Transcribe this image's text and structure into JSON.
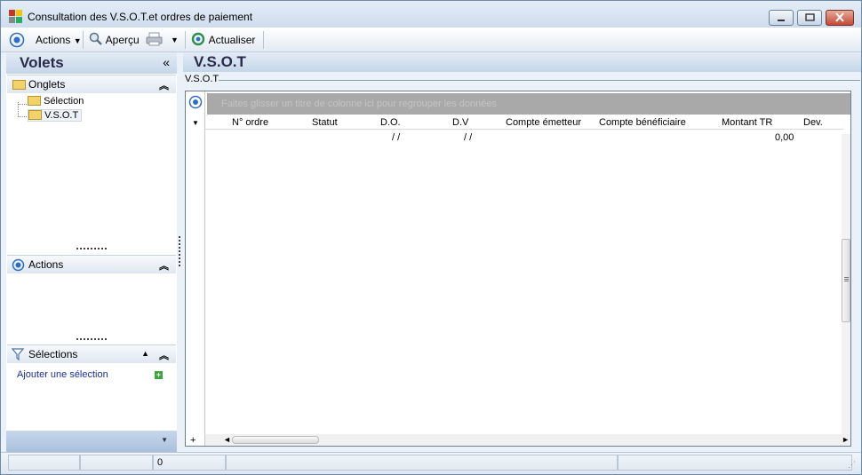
{
  "window": {
    "title": "Consultation des V.S.O.T.et ordres de paiement"
  },
  "toolbar": {
    "actions_label": "Actions",
    "apercu_label": "Aperçu",
    "actualiser_label": "Actualiser"
  },
  "leftpanel": {
    "title": "Volets",
    "onglets": {
      "title": "Onglets",
      "items": [
        "Sélection",
        "V.S.O.T"
      ]
    },
    "actions": {
      "title": "Actions"
    },
    "selections": {
      "title": "Sélections",
      "add_label": "Ajouter une sélection"
    }
  },
  "main": {
    "title": "V.S.O.T",
    "tab_label": "V.S.O.T",
    "grid": {
      "group_hint": "Faites glisser un titre de colonne ici pour regrouper les données",
      "columns": [
        "N° ordre",
        "Statut",
        "D.O.",
        "D.V",
        "Compte émetteur",
        "Compte bénéficiaire",
        "Montant TR",
        "Dev."
      ],
      "row": {
        "do": " /  /",
        "dv": " /  /",
        "montant": "0,00"
      }
    }
  },
  "statusbar": {
    "count": "0"
  },
  "colors": {
    "accent": "#2f6fc1",
    "panel_header": "#c5d6e9",
    "group_bar": "#a9a9a9"
  }
}
